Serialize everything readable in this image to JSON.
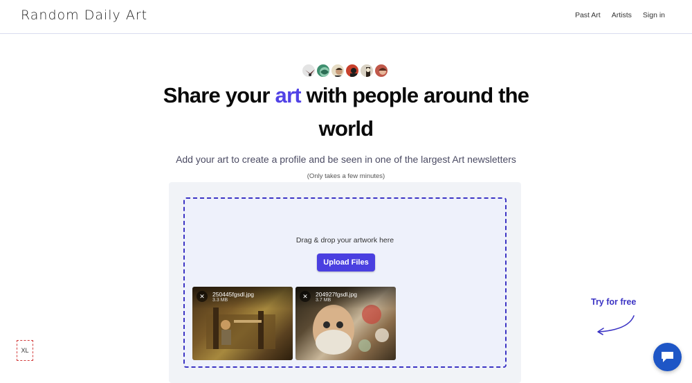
{
  "header": {
    "logo": "Random Daily Art",
    "nav": [
      {
        "label": "Past Art"
      },
      {
        "label": "Artists"
      },
      {
        "label": "Sign in"
      }
    ]
  },
  "avatars": [
    {
      "icon": "avatar-icon",
      "color": "#c9c9c9"
    },
    {
      "icon": "avatar-icon",
      "color": "#3f8f6f"
    },
    {
      "icon": "avatar-icon",
      "color": "#d8c9a8"
    },
    {
      "icon": "avatar-icon",
      "color": "#c8402c"
    },
    {
      "icon": "avatar-icon",
      "color": "#d9d2c4"
    },
    {
      "icon": "avatar-icon",
      "color": "#c0584a"
    }
  ],
  "hero": {
    "title_before": "Share your ",
    "title_accent": "art",
    "title_after": " with people around the world",
    "subtitle": "Add your art to create a profile and be seen in one of the largest Art newsletters",
    "note": "(Only takes a few minutes)"
  },
  "upload": {
    "drop_text": "Drag & drop your artwork here",
    "button_label": "Upload Files",
    "files": [
      {
        "name": "250445fgsdl.jpg",
        "size": "3.3 MB",
        "close_icon": "close-icon"
      },
      {
        "name": "204927fgsdl.jpg",
        "size": "3.7 MB",
        "close_icon": "close-icon"
      }
    ]
  },
  "promo": {
    "try_free": "Try for free"
  },
  "badge": {
    "label": "XL"
  },
  "chat": {
    "icon": "chat-icon"
  },
  "colors": {
    "accent": "#5142e6",
    "button": "#4a3fe0",
    "dashed_border": "#3b33c4",
    "chat": "#1e56c6"
  }
}
